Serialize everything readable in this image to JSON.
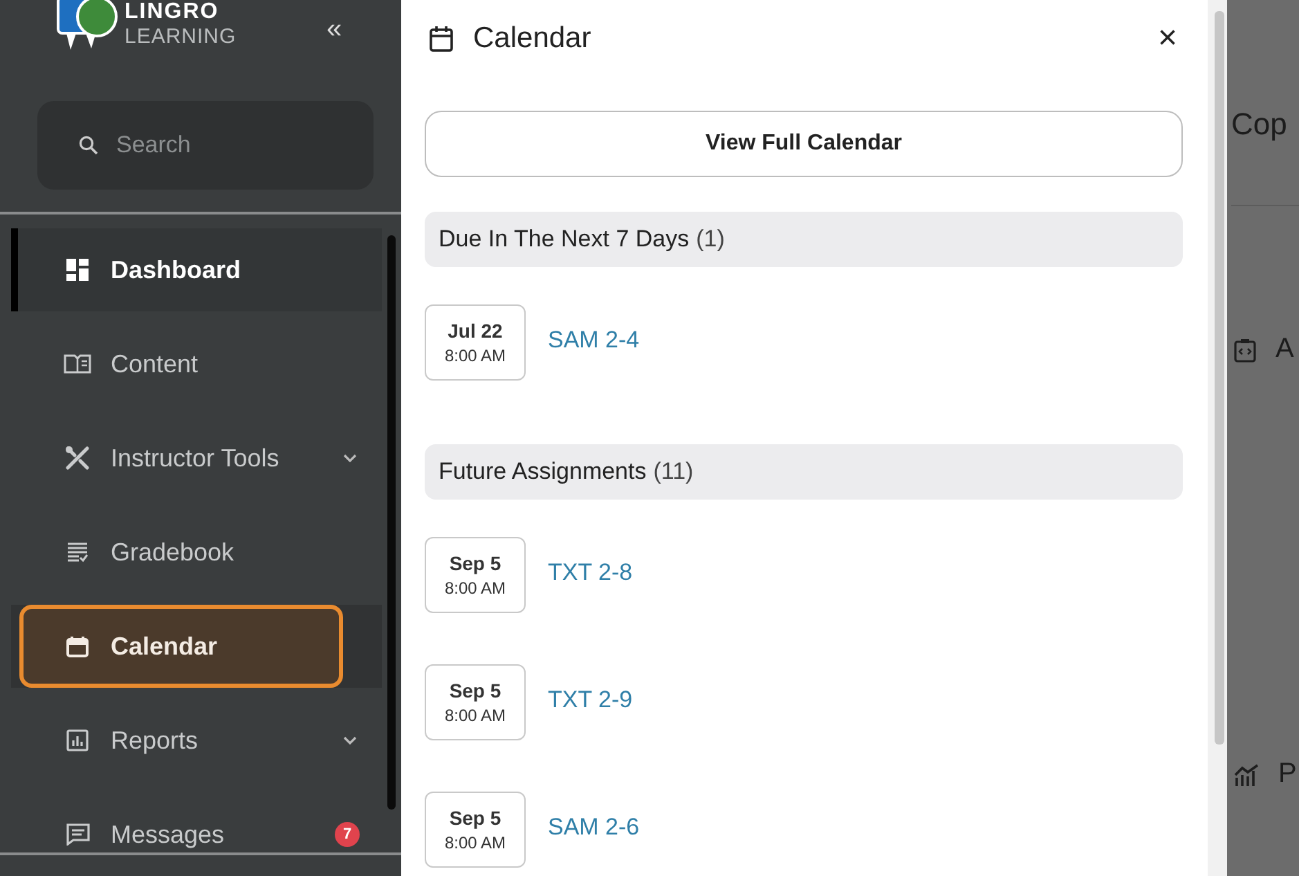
{
  "sidebar": {
    "logo": {
      "name": "LINGRO",
      "tagline": "LEARNING"
    },
    "collapse": "«",
    "search": {
      "placeholder": "Search"
    },
    "items": [
      {
        "label": "Dashboard",
        "selected": true,
        "highlighted": false,
        "expandable": false
      },
      {
        "label": "Content",
        "selected": false,
        "highlighted": false,
        "expandable": false
      },
      {
        "label": "Instructor Tools",
        "selected": false,
        "highlighted": false,
        "expandable": true
      },
      {
        "label": "Gradebook",
        "selected": false,
        "highlighted": false,
        "expandable": false
      },
      {
        "label": "Calendar",
        "selected": false,
        "highlighted": true,
        "expandable": false
      },
      {
        "label": "Reports",
        "selected": false,
        "highlighted": false,
        "expandable": true
      },
      {
        "label": "Messages",
        "selected": false,
        "highlighted": false,
        "expandable": false,
        "badge": "7"
      }
    ]
  },
  "calendar_panel": {
    "title": "Calendar",
    "close": "×",
    "full_calendar_button": "View Full Calendar",
    "sections": [
      {
        "title": "Due In The Next 7 Days",
        "count": "(1)",
        "entries": [
          {
            "date": "Jul 22",
            "time": "8:00 AM",
            "name": "SAM 2-4"
          }
        ]
      },
      {
        "title": "Future Assignments",
        "count": "(11)",
        "entries": [
          {
            "date": "Sep 5",
            "time": "8:00 AM",
            "name": "TXT 2-8"
          },
          {
            "date": "Sep 5",
            "time": "8:00 AM",
            "name": "TXT 2-9"
          },
          {
            "date": "Sep 5",
            "time": "8:00 AM",
            "name": "SAM 2-6"
          }
        ]
      }
    ]
  },
  "background": {
    "heading": "Cop",
    "items": [
      "A",
      "P"
    ]
  }
}
